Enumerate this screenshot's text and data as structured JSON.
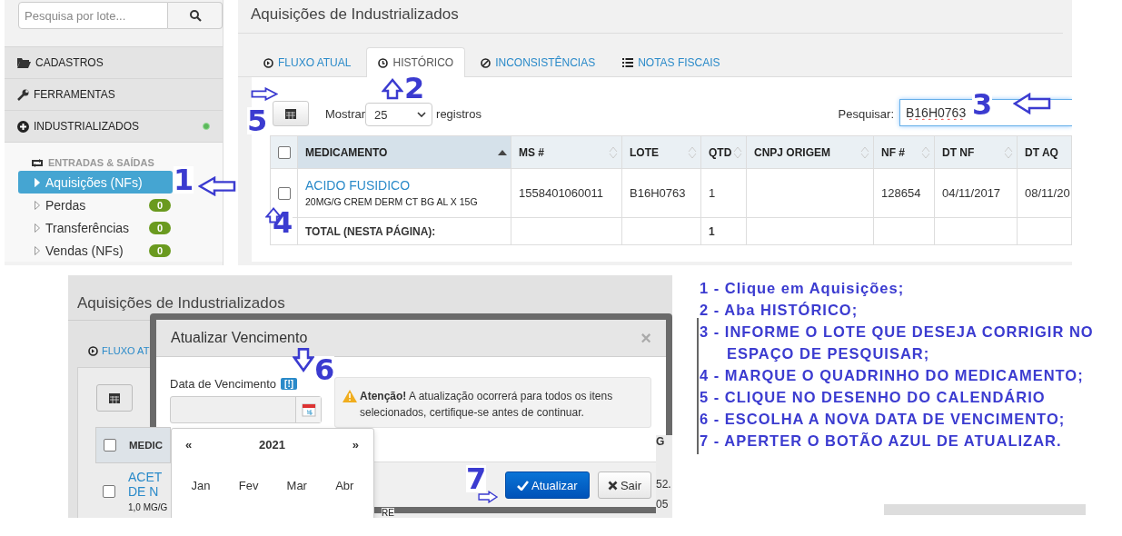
{
  "sidebar": {
    "search_placeholder": "Pesquisa por lote...",
    "menu": [
      {
        "label": "CADASTROS",
        "kind": "folder",
        "status_dot": false
      },
      {
        "label": "FERRAMENTAS",
        "kind": "wrench",
        "status_dot": false
      },
      {
        "label": "INDUSTRIALIZADOS",
        "kind": "plus",
        "status_dot": true
      }
    ],
    "section": "ENTRADAS & SAÍDAS",
    "items": [
      {
        "label": "Aquisições (NFs)",
        "selected": true
      },
      {
        "label": "Perdas",
        "selected": false,
        "badge": "0"
      },
      {
        "label": "Transferências",
        "selected": false,
        "badge": "0"
      },
      {
        "label": "Vendas (NFs)",
        "selected": false,
        "badge": "0"
      }
    ]
  },
  "main": {
    "title": "Aquisições de Industrializados",
    "tabs": [
      {
        "label": "FLUXO ATUAL",
        "kind": "play",
        "selected": false
      },
      {
        "label": "HISTÓRICO",
        "kind": "clock",
        "selected": true
      },
      {
        "label": "INCONSISTÊNCIAS",
        "kind": "ban",
        "selected": false
      },
      {
        "label": "NOTAS FISCAIS",
        "kind": "list",
        "selected": false
      }
    ],
    "show_label": "Mostrar",
    "page_size": "25",
    "records_label": "registros",
    "search_label": "Pesquisar:",
    "search_value": "B16H0763",
    "table": {
      "select_all_checked": false,
      "columns": [
        {
          "label": "MEDICAMENTO",
          "sortable": true,
          "sorted": true
        },
        {
          "label": "MS #",
          "sortable": true,
          "sorted": false
        },
        {
          "label": "LOTE",
          "sortable": true,
          "sorted": false
        },
        {
          "label": "QTD",
          "sortable": true,
          "sorted": false
        },
        {
          "label": "CNPJ ORIGEM",
          "sortable": true,
          "sorted": false
        },
        {
          "label": "NF #",
          "sortable": true,
          "sorted": false
        },
        {
          "label": "DT NF",
          "sortable": true,
          "sorted": false
        },
        {
          "label": "DT AQ",
          "sortable": false,
          "sorted": false
        }
      ],
      "rows": [
        {
          "checked": false,
          "detail": "20MG/G CREM DERM CT BG AL X 15G",
          "cells": [
            "ACIDO FUSIDICO",
            "1558401060011",
            "B16H0763",
            "1",
            "",
            "128654",
            "04/11/2017",
            "08/11/20"
          ]
        }
      ],
      "total": {
        "cells": [
          "TOTAL (NESTA PÁGINA):",
          "",
          "",
          "1",
          "",
          "",
          "",
          ""
        ]
      }
    }
  },
  "modal_shot": {
    "page_title": "Aquisições de Industrializados",
    "tab": "FLUXO AT",
    "header_checked": false,
    "header_text": "MEDIC",
    "row_checked": false,
    "row_name_lines": [
      "ACET",
      "DE N"
    ],
    "row_detail": "1,0 MG/G",
    "row_detail_end": "RE",
    "edge_texts": [
      "G",
      "52.",
      "05"
    ],
    "modal": {
      "title": "Atualizar Vencimento",
      "close": "×",
      "field_label": "Data de Vencimento",
      "hint_badge": "[!]",
      "alert": "**Atenção!** A atualização ocorrerá para todos os itens selecionados, certifique-se antes de continuar.",
      "picker": {
        "prev": "«",
        "year": "2021",
        "next": "»",
        "months": [
          "Jan",
          "Fev",
          "Mar",
          "Abr"
        ]
      },
      "buttons": [
        {
          "label": "Atualizar",
          "kind": "primary"
        },
        {
          "label": "Sair",
          "kind": "close"
        }
      ]
    }
  },
  "callouts": [
    {
      "number": "1",
      "kind": "left"
    },
    {
      "number": "2",
      "kind": "up"
    },
    {
      "number": "3",
      "kind": "left"
    },
    {
      "number": "4",
      "kind": "up"
    },
    {
      "number": "5",
      "kind": "right"
    },
    {
      "number": "6",
      "kind": "down"
    },
    {
      "number": "7",
      "kind": "right"
    }
  ],
  "steps": [
    "1 - Clique em Aquisições;",
    "2 - Aba HISTÓRICO;",
    "3 - INFORME O LOTE QUE DESEJA CORRIGIR NO ESPAÇO DE PESQUISAR;",
    "4 - MARQUE O QUADRINHO DO MEDICAMENTO;",
    "5 - CLIQUE NO DESENHO DO CALENDÁRIO",
    "6 - ESCOLHA A NOVA DATA DE VENCIMENTO;",
    "7 - APERTER O BOTÃO AZUL DE ATUALIZAR."
  ]
}
